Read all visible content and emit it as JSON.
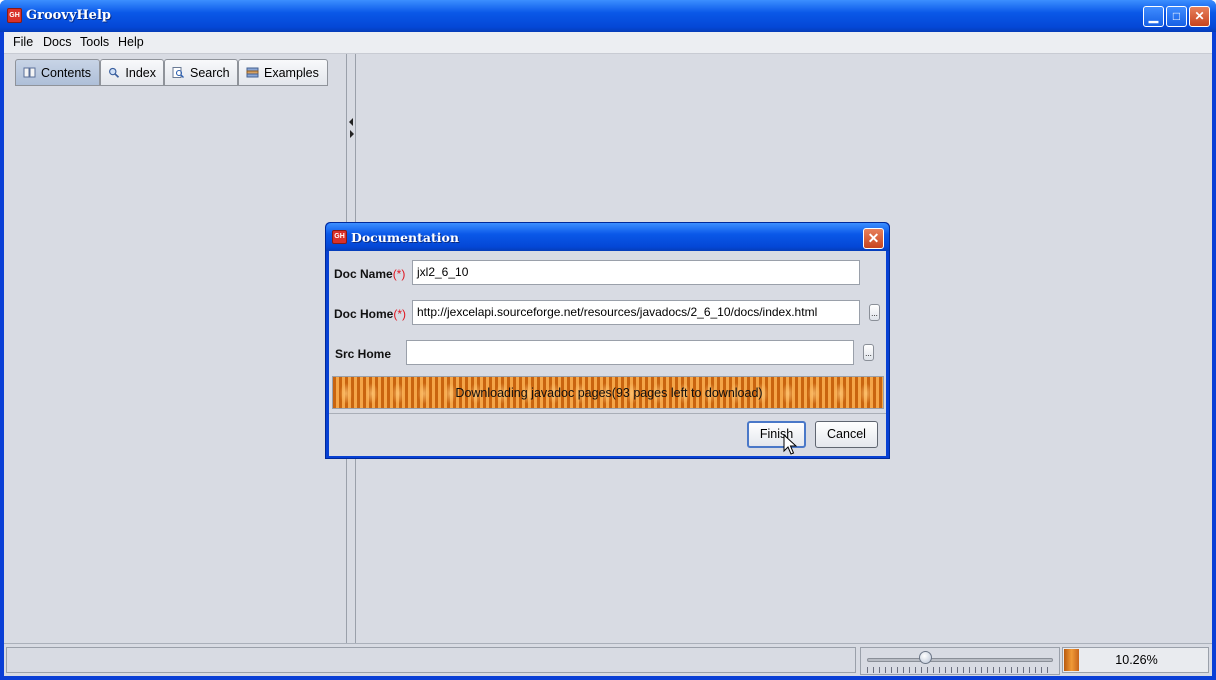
{
  "window": {
    "title": "GroovyHelp",
    "icon_text": "GH"
  },
  "titlebar_buttons": {
    "minimize": "minimize-icon",
    "maximize": "maximize-icon",
    "close": "close-icon"
  },
  "menu": [
    "File",
    "Docs",
    "Tools",
    "Help"
  ],
  "tabs": [
    {
      "label": "Contents",
      "icon": "book-icon",
      "active": true
    },
    {
      "label": "Index",
      "icon": "magnifier-icon",
      "active": false
    },
    {
      "label": "Search",
      "icon": "search-doc-icon",
      "active": false
    },
    {
      "label": "Examples",
      "icon": "examples-icon",
      "active": false
    }
  ],
  "statusbar": {
    "status_text": "",
    "zoom_level": 0.31,
    "progress_percent": "10.26%",
    "progress_value": 0.1026
  },
  "dialog": {
    "title": "Documentation",
    "icon_text": "GH",
    "fields": {
      "doc_name": {
        "label": "Doc Name",
        "required_mark": "(*)",
        "value": "jxl2_6_10"
      },
      "doc_home": {
        "label": "Doc Home",
        "required_mark": "(*)",
        "value": "http://jexcelapi.sourceforge.net/resources/javadocs/2_6_10/docs/index.html"
      },
      "src_home": {
        "label": "Src Home",
        "value": ""
      }
    },
    "browse_label": "...",
    "progress_text": "Downloading javadoc pages(93 pages left to download)",
    "buttons": {
      "finish": "Finish",
      "cancel": "Cancel"
    }
  },
  "colors": {
    "titlebar": "#0a58e8",
    "progress": "#e8862a",
    "required": "#e0141e",
    "background": "#d8dbe3"
  }
}
